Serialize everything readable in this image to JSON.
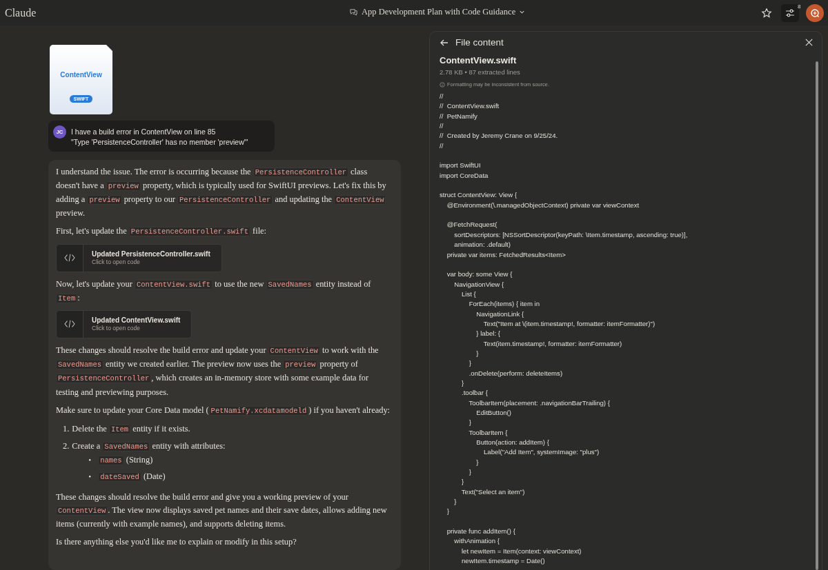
{
  "header": {
    "brand": "Claude",
    "conversation_title": "App Development Plan with Code Guidance",
    "badge": "8"
  },
  "attachment": {
    "name": "ContentView",
    "type": "SWIFT"
  },
  "user_message": {
    "initials": "JC",
    "lines": [
      "I have a build error in ContentView on line 85",
      "\"Type 'PersistenceController' has no member 'preview'\""
    ]
  },
  "assistant_message": {
    "blocks": [
      {
        "kind": "paragraph",
        "parts": [
          {
            "kind": "text",
            "text": "I understand the issue. The error is occurring because the "
          },
          {
            "kind": "code",
            "text": "PersistenceController"
          },
          {
            "kind": "text",
            "text": " class doesn't have a "
          },
          {
            "kind": "code",
            "text": "preview"
          },
          {
            "kind": "text",
            "text": " property, which is typically used for SwiftUI previews. Let's fix this by adding a "
          },
          {
            "kind": "code",
            "text": "preview"
          },
          {
            "kind": "text",
            "text": " property to our "
          },
          {
            "kind": "code",
            "text": "PersistenceController"
          },
          {
            "kind": "text",
            "text": " and updating the "
          },
          {
            "kind": "code",
            "text": "ContentView"
          },
          {
            "kind": "text",
            "text": " preview."
          }
        ]
      },
      {
        "kind": "paragraph",
        "parts": [
          {
            "kind": "text",
            "text": "First, let's update the "
          },
          {
            "kind": "code",
            "text": "PersistenceController.swift"
          },
          {
            "kind": "text",
            "text": " file:"
          }
        ]
      },
      {
        "kind": "artifact",
        "title": "Updated PersistenceController.swift",
        "subtitle": "Click to open code"
      },
      {
        "kind": "paragraph",
        "parts": [
          {
            "kind": "text",
            "text": "Now, let's update your "
          },
          {
            "kind": "code",
            "text": "ContentView.swift"
          },
          {
            "kind": "text",
            "text": " to use the new "
          },
          {
            "kind": "code",
            "text": "SavedNames"
          },
          {
            "kind": "text",
            "text": " entity instead of "
          },
          {
            "kind": "code",
            "text": "Item"
          },
          {
            "kind": "text",
            "text": ":"
          }
        ]
      },
      {
        "kind": "artifact",
        "title": "Updated ContentView.swift",
        "subtitle": "Click to open code"
      },
      {
        "kind": "paragraph",
        "parts": [
          {
            "kind": "text",
            "text": "These changes should resolve the build error and update your "
          },
          {
            "kind": "code",
            "text": "ContentView"
          },
          {
            "kind": "text",
            "text": " to work with the "
          },
          {
            "kind": "code",
            "text": "SavedNames"
          },
          {
            "kind": "text",
            "text": " entity we created earlier. The preview now uses the "
          },
          {
            "kind": "code",
            "text": "preview"
          },
          {
            "kind": "text",
            "text": " property of "
          },
          {
            "kind": "code",
            "text": "PersistenceController"
          },
          {
            "kind": "text",
            "text": ", which creates an in-memory store with some example data for testing and previewing purposes."
          }
        ]
      },
      {
        "kind": "paragraph",
        "parts": [
          {
            "kind": "text",
            "text": "Make sure to update your Core Data model ("
          },
          {
            "kind": "code",
            "text": "PetNamify.xcdatamodeld"
          },
          {
            "kind": "text",
            "text": ") if you haven't already:"
          }
        ]
      },
      {
        "kind": "list",
        "items": [
          {
            "marker": "1.",
            "parts": [
              {
                "kind": "text",
                "text": "Delete the "
              },
              {
                "kind": "code",
                "text": "Item"
              },
              {
                "kind": "text",
                "text": " entity if it exists."
              }
            ]
          },
          {
            "marker": "2.",
            "parts": [
              {
                "kind": "text",
                "text": "Create a "
              },
              {
                "kind": "code",
                "text": "SavedNames"
              },
              {
                "kind": "text",
                "text": " entity with attributes:"
              }
            ],
            "children": [
              {
                "marker": "•",
                "parts": [
                  {
                    "kind": "code",
                    "text": "names"
                  },
                  {
                    "kind": "text",
                    "text": " (String)"
                  }
                ]
              },
              {
                "marker": "•",
                "parts": [
                  {
                    "kind": "code",
                    "text": "dateSaved"
                  },
                  {
                    "kind": "text",
                    "text": " (Date)"
                  }
                ]
              }
            ]
          }
        ]
      },
      {
        "kind": "paragraph",
        "parts": [
          {
            "kind": "text",
            "text": "These changes should resolve the build error and give you a working preview of your "
          },
          {
            "kind": "code",
            "text": "ContentView"
          },
          {
            "kind": "text",
            "text": ". The view now displays saved pet names and their save dates, allows adding new items (currently with example names), and supports deleting items."
          }
        ]
      },
      {
        "kind": "paragraph",
        "parts": [
          {
            "kind": "text",
            "text": "Is there anything else you'd like me to explain or modify in this setup?"
          }
        ]
      }
    ]
  },
  "file_panel": {
    "heading": "File content",
    "file_name": "ContentView.swift",
    "meta": "2.78 KB • 87 extracted lines",
    "notice": "Formatting may be inconsistent from source.",
    "code": "//\n//  ContentView.swift\n//  PetNamify\n//\n//  Created by Jeremy Crane on 9/25/24.\n//\n\nimport SwiftUI\nimport CoreData\n\nstruct ContentView: View {\n    @Environment(\\.managedObjectContext) private var viewContext\n\n    @FetchRequest(\n        sortDescriptors: [NSSortDescriptor(keyPath: \\Item.timestamp, ascending: true)],\n        animation: .default)\n    private var items: FetchedResults<Item>\n\n    var body: some View {\n        NavigationView {\n            List {\n                ForEach(items) { item in\n                    NavigationLink {\n                        Text(\"Item at \\(item.timestamp!, formatter: itemFormatter)\")\n                    } label: {\n                        Text(item.timestamp!, formatter: itemFormatter)\n                    }\n                }\n                .onDelete(perform: deleteItems)\n            }\n            .toolbar {\n                ToolbarItem(placement: .navigationBarTrailing) {\n                    EditButton()\n                }\n                ToolbarItem {\n                    Button(action: addItem) {\n                        Label(\"Add Item\", systemImage: \"plus\")\n                    }\n                }\n            }\n            Text(\"Select an item\")\n        }\n    }\n\n    private func addItem() {\n        withAnimation {\n            let newItem = Item(context: viewContext)\n            newItem.timestamp = Date()"
  }
}
